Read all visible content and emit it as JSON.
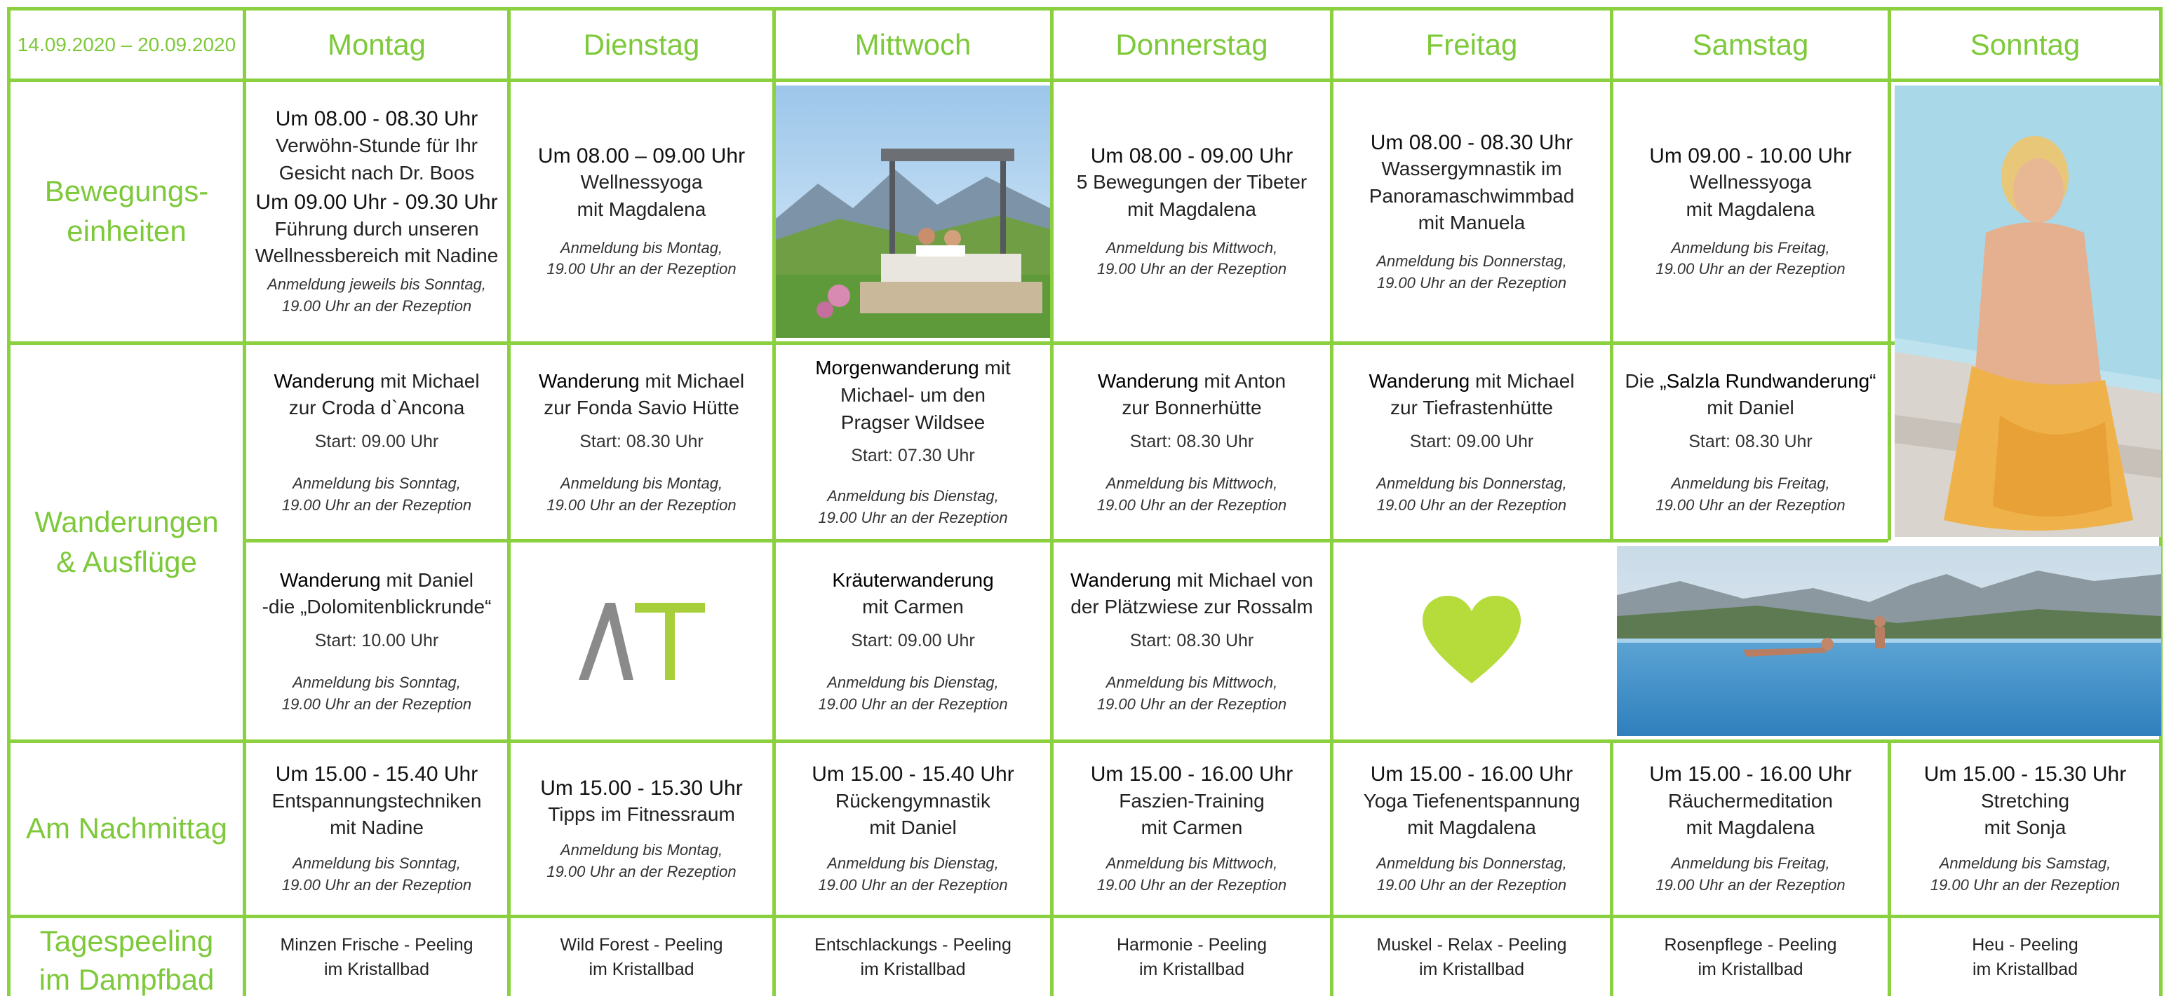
{
  "accent": "#8bd13f",
  "header": {
    "date_range": "14.09.2020 – 20.09.2020",
    "days": [
      "Montag",
      "Dienstag",
      "Mittwoch",
      "Donnerstag",
      "Freitag",
      "Samstag",
      "Sonntag"
    ]
  },
  "rows": {
    "bewegung": "Bewegungs-\neinheiten",
    "wanderungen": "Wanderungen\n& Ausflüge",
    "nachmittag": "Am Nachmittag",
    "peeling": "Tagespeeling\nim Dampfbad"
  },
  "bewegung": {
    "mon": {
      "time1": "Um 08.00 - 08.30 Uhr",
      "text1": "Verwöhn-Stunde für Ihr\nGesicht nach Dr. Boos",
      "time2": "Um 09.00 Uhr - 09.30 Uhr",
      "text2": "Führung durch unseren\nWellnessbereich mit Nadine",
      "note": "Anmeldung jeweils bis Sonntag,\n19.00 Uhr an der Rezeption"
    },
    "tue": {
      "time": "Um 08.00 – 09.00 Uhr",
      "text": "Wellnessyoga\nmit Magdalena",
      "note": "Anmeldung bis Montag,\n19.00 Uhr an der Rezeption"
    },
    "thu": {
      "time": "Um 08.00 - 09.00 Uhr",
      "text": "5 Bewegungen der Tibeter\nmit Magdalena",
      "note": "Anmeldung bis Mittwoch,\n19.00 Uhr an der Rezeption"
    },
    "fri": {
      "time": "Um 08.00 - 08.30 Uhr",
      "text": "Wassergymnastik im\nPanoramaschwimmbad\nmit Manuela",
      "note": "Anmeldung bis Donnerstag,\n19.00 Uhr an der Rezeption"
    },
    "sat": {
      "time": "Um 09.00 - 10.00 Uhr",
      "text": "Wellnessyoga\nmit Magdalena",
      "note": "Anmeldung bis Freitag,\n19.00 Uhr an der Rezeption"
    }
  },
  "wander1": {
    "mon": {
      "bold": "Wanderung",
      "rest": " mit Michael",
      "line2": "zur Croda d`Ancona",
      "start": "Start: 09.00 Uhr",
      "note": "Anmeldung bis Sonntag,\n19.00 Uhr an der Rezeption"
    },
    "tue": {
      "bold": "Wanderung",
      "rest": " mit Michael",
      "line2": "zur Fonda Savio Hütte",
      "start": "Start: 08.30 Uhr",
      "note": "Anmeldung bis Montag,\n19.00 Uhr an der Rezeption"
    },
    "wed": {
      "bold": "Morgenwanderung",
      "rest": " mit",
      "line2": "Michael- um den\nPragser Wildsee",
      "start": "Start: 07.30 Uhr",
      "note": "Anmeldung bis Dienstag,\n19.00 Uhr an der Rezeption"
    },
    "thu": {
      "bold": "Wanderung",
      "rest": " mit Anton",
      "line2": "zur Bonnerhütte",
      "start": "Start: 08.30 Uhr",
      "note": "Anmeldung bis Mittwoch,\n19.00 Uhr an der Rezeption"
    },
    "fri": {
      "bold": "Wanderung",
      "rest": " mit Michael",
      "line2": "zur Tiefrastenhütte",
      "start": "Start: 09.00 Uhr",
      "note": "Anmeldung bis Donnerstag,\n19.00 Uhr an der Rezeption"
    },
    "sat": {
      "pre": "Die ",
      "bold": "„Salzla Rundwanderung“",
      "line2": "mit Daniel",
      "start": "Start: 08.30 Uhr",
      "note": "Anmeldung bis Freitag,\n19.00 Uhr an der Rezeption"
    }
  },
  "wander2": {
    "mon": {
      "bold": "Wanderung",
      "rest": " mit Daniel",
      "line2": "-die „Dolomitenblickrunde“",
      "start": "Start: 10.00 Uhr",
      "note": "Anmeldung bis Sonntag,\n19.00 Uhr an der Rezeption"
    },
    "tue_logo": "AT",
    "wed": {
      "bold": "Kräuterwanderung",
      "line2": "mit Carmen",
      "start": "Start: 09.00 Uhr",
      "note": "Anmeldung bis Dienstag,\n19.00 Uhr an der Rezeption"
    },
    "thu": {
      "bold": "Wanderung",
      "rest": " mit Michael von",
      "line2": "der Plätzwiese zur Rossalm",
      "start": "Start: 08.30 Uhr",
      "note": "Anmeldung bis Mittwoch,\n19.00 Uhr an der Rezeption"
    }
  },
  "nachmittag": {
    "mon": {
      "time": "Um 15.00 - 15.40 Uhr",
      "text": "Entspannungstechniken\nmit Nadine",
      "note": "Anmeldung bis Sonntag,\n19.00 Uhr an der Rezeption"
    },
    "tue": {
      "time": "Um 15.00 - 15.30 Uhr",
      "text": "Tipps im Fitnessraum",
      "note": "Anmeldung bis Montag,\n19.00 Uhr an der Rezeption"
    },
    "wed": {
      "time": "Um 15.00 - 15.40 Uhr",
      "text": "Rückengymnastik\nmit Daniel",
      "note": "Anmeldung bis Dienstag,\n19.00 Uhr an der Rezeption"
    },
    "thu": {
      "time": "Um 15.00 - 16.00 Uhr",
      "text": "Faszien-Training\nmit Carmen",
      "note": "Anmeldung bis Mittwoch,\n19.00 Uhr an der Rezeption"
    },
    "fri": {
      "time": "Um 15.00 - 16.00 Uhr",
      "text": "Yoga Tiefenentspannung\nmit Magdalena",
      "note": "Anmeldung bis Donnerstag,\n19.00 Uhr an der Rezeption"
    },
    "sat": {
      "time": "Um 15.00 - 16.00 Uhr",
      "text": "Räuchermeditation\nmit Magdalena",
      "note": "Anmeldung bis Freitag,\n19.00 Uhr an der Rezeption"
    },
    "sun": {
      "time": "Um 15.00 - 15.30 Uhr",
      "text": "Stretching\nmit Sonja",
      "note": "Anmeldung bis Samstag,\n19.00 Uhr an der Rezeption"
    }
  },
  "peeling": {
    "mon": "Minzen Frische - Peeling\nim Kristallbad",
    "tue": "Wild Forest - Peeling\nim Kristallbad",
    "wed": "Entschlackungs - Peeling\nim Kristallbad",
    "thu": "Harmonie - Peeling\nim Kristallbad",
    "fri": "Muskel - Relax - Peeling\nim Kristallbad",
    "sat": "Rosenpflege - Peeling\nim Kristallbad",
    "sun": "Heu - Peeling\nim Kristallbad"
  },
  "logo_colors": {
    "gray": "#8a8a8a",
    "green": "#a7cf3a"
  },
  "heart_color": "#b5dc3a"
}
